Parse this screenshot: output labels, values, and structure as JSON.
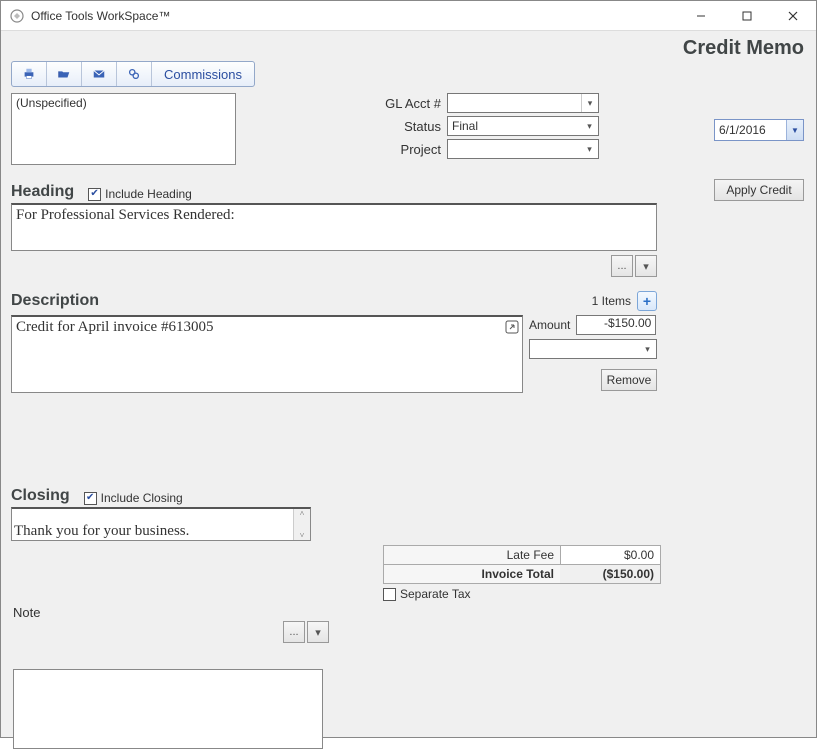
{
  "window": {
    "title": "Office Tools WorkSpace™"
  },
  "page": {
    "title": "Credit Memo"
  },
  "toolbar": {
    "commissions_label": "Commissions"
  },
  "unspecified": {
    "text": "(Unspecified)"
  },
  "fields": {
    "gl_acct": {
      "label": "GL Acct #",
      "value": ""
    },
    "status": {
      "label": "Status",
      "value": "Final"
    },
    "project": {
      "label": "Project",
      "value": ""
    }
  },
  "date": {
    "value": "6/1/2016"
  },
  "apply_credit": {
    "label": "Apply Credit"
  },
  "heading": {
    "section": "Heading",
    "include_label": "Include Heading",
    "include_checked": true,
    "text": "For Professional Services Rendered:"
  },
  "description": {
    "section": "Description",
    "count_label": "1 Items",
    "items": [
      {
        "text": "Credit for April invoice #613005",
        "amount": "-$150.00"
      }
    ],
    "amount_label": "Amount",
    "remove_label": "Remove"
  },
  "closing": {
    "section": "Closing",
    "include_label": "Include Closing",
    "include_checked": true,
    "text": "Thank you for your business."
  },
  "totals": {
    "late_fee_label": "Late Fee",
    "late_fee_value": "$0.00",
    "invoice_total_label": "Invoice Total",
    "invoice_total_value": "($150.00)",
    "separate_tax_label": "Separate Tax",
    "separate_tax_checked": false
  },
  "note": {
    "label": "Note",
    "text": ""
  },
  "ellipsis": "...",
  "caret_down": "▾"
}
